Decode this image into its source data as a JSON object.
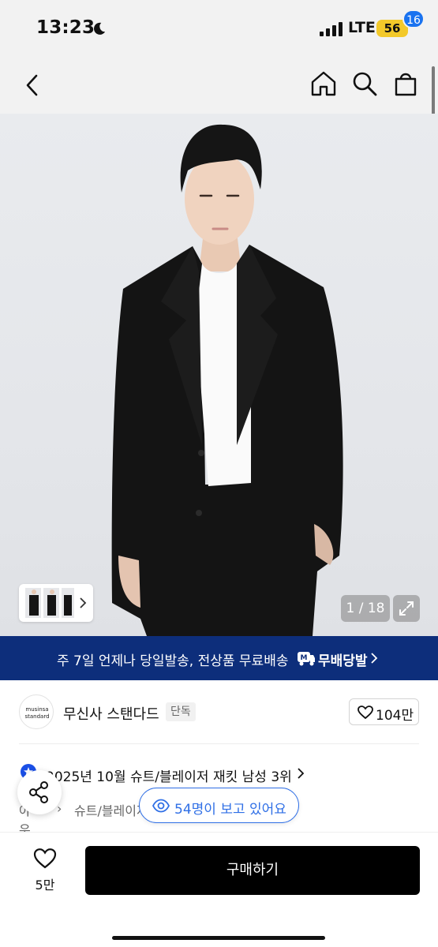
{
  "status_bar": {
    "time": "13:23",
    "network": "LTE",
    "battery": "56"
  },
  "nav": {
    "cart_badge": "16"
  },
  "hero": {
    "counter": "1 / 18"
  },
  "promo": {
    "text": "주 7일 언제나 당일발송, 전상품 무료배송",
    "brand": "무배당발"
  },
  "brand": {
    "logo_line1": "musinsa",
    "logo_line2": "standard",
    "name": "무신사 스탠다드",
    "tag": "단독"
  },
  "like": {
    "count": "104만"
  },
  "ranking": {
    "text": "2025년 10월 슈트/블레이저 재킷 남성 3위"
  },
  "breadcrumb": {
    "home": "아우터",
    "category": "슈트/블레이저 재킷"
  },
  "viewers": {
    "text": "54명이 보고 있어요"
  },
  "bottom": {
    "wish_count": "5만",
    "buy_label": "구매하기"
  },
  "colors": {
    "accent": "#1a73f0",
    "promo_bg": "#0d2e7b",
    "buy_bg": "#000000"
  }
}
